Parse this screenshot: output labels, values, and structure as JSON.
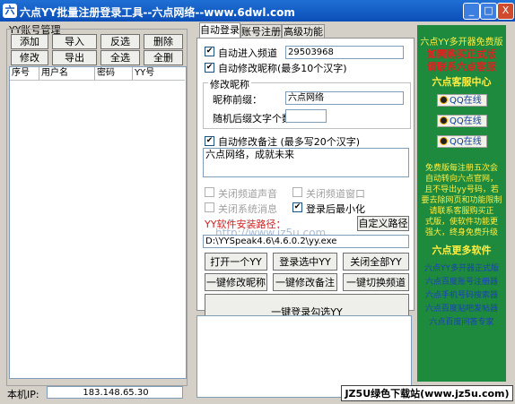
{
  "window": {
    "icon_text": "六",
    "title": "六点YY批量注册登录工具--六点网络--www.6dwl.com",
    "min_label": "_",
    "max_label": "□",
    "close_label": "X"
  },
  "left": {
    "group_title": "YY账号管理",
    "buttons": [
      "添加",
      "导入",
      "反选",
      "删除",
      "修改",
      "导出",
      "全选",
      "全删"
    ],
    "columns": [
      "序号",
      "用户名",
      "密码",
      "YY号"
    ],
    "ip_label": "本机IP:",
    "ip_value": "183.148.65.30"
  },
  "tabs": [
    "自动登录",
    "账号注册",
    "高级功能"
  ],
  "login": {
    "auto_enter_label": "自动进入频道",
    "auto_enter_checked": true,
    "channel_value": "29503968",
    "auto_nick_label": "自动修改昵称(最多10个汉字)",
    "auto_nick_checked": true,
    "nick_group_title": "修改昵称",
    "nick_prefix_label": "昵称前缀：",
    "nick_prefix_value": "六点网络",
    "random_suffix_label": "随机后缀文字个数：",
    "random_suffix_value": "",
    "auto_note_label": "自动修改备注 (最多写20个汉字)",
    "auto_note_checked": true,
    "note_text": "六点网络，成就未来",
    "opt_close_sound": "关闭频道声音",
    "opt_close_window": "关闭频道窗口",
    "opt_close_sysmsg": "关闭系统消息",
    "opt_minimize_label": "登录后最小化",
    "opt_minimize_checked": true,
    "path_label": "YY软件安装路径：",
    "watermark": "http://www.jz5u.com",
    "custom_path_button": "自定义路径",
    "path_value": "D:\\YYSpeak4.6\\4.6.0.2\\yy.exe",
    "btn_open": "打开一个YY",
    "btn_login_selected": "登录选中YY",
    "btn_close_all": "关闭全部YY",
    "btn_edit_nick": "一键修改昵称",
    "btn_edit_note": "一键修改备注",
    "btn_switch_channel": "一键切换频道",
    "btn_login_checked": "一键登录勾选YY"
  },
  "ad": {
    "title": "六点YY多开器免费版",
    "line1": "如需购买正式版",
    "line2": "请联系六点客服",
    "service_center": "六点客服中心",
    "qq_label": "QQ在线",
    "promo": [
      "免费版每注册五次会",
      "自动转向六点官网，",
      "且不导出yy号码，若",
      "要去除网页和功能限制",
      "请联系客服购买正",
      "式版，使软件功能更",
      "强大，终身免费升级"
    ],
    "more_title": "六点更多软件",
    "more_items": [
      "六点YY多开器正式版",
      "六点百度账号注册器",
      "六点手机号码搜索器",
      "六点百度贴吧发帖器",
      "六点百度问答专家"
    ],
    "bottom_text": "JZ5U绿色下载站(www.jz5u.com)"
  },
  "colors": {
    "title_bar": "#0b4fb8",
    "ad_bg": "#1e8a3d",
    "ad_heading": "#ffee44",
    "ad_red": "#e02020",
    "link_blue": "#1c3fc0"
  }
}
